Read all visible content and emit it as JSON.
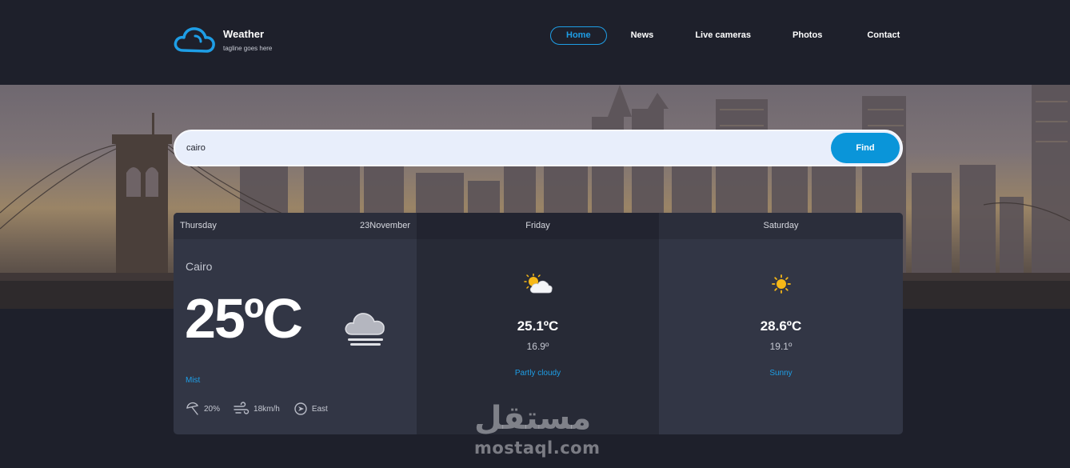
{
  "brand": {
    "title": "Weather",
    "tagline": "tagline goes here"
  },
  "nav": {
    "items": [
      {
        "label": "Home",
        "active": true
      },
      {
        "label": "News",
        "active": false
      },
      {
        "label": "Live cameras",
        "active": false
      },
      {
        "label": "Photos",
        "active": false
      },
      {
        "label": "Contact",
        "active": false
      }
    ]
  },
  "search": {
    "value": "cairo",
    "button_label": "Find"
  },
  "forecast": {
    "today": {
      "day": "Thursday",
      "date": "23November",
      "city": "Cairo",
      "temperature": "25ºC",
      "icon": "mist-cloud-icon",
      "condition": "Mist",
      "humidity": "20%",
      "wind_speed": "18km/h",
      "wind_direction": "East"
    },
    "next": [
      {
        "day": "Friday",
        "icon": "partly-cloudy-icon",
        "max_temp": "25.1ºC",
        "min_temp": "16.9º",
        "condition": "Partly cloudy"
      },
      {
        "day": "Saturday",
        "icon": "sun-icon",
        "max_temp": "28.6ºC",
        "min_temp": "19.1º",
        "condition": "Sunny"
      }
    ]
  },
  "watermark": {
    "arabic": "مستقل",
    "latin": "mostaql.com"
  },
  "colors": {
    "accent": "#1e9ee6",
    "button": "#0a95d9",
    "background": "#1e202b",
    "card": "#323645"
  }
}
